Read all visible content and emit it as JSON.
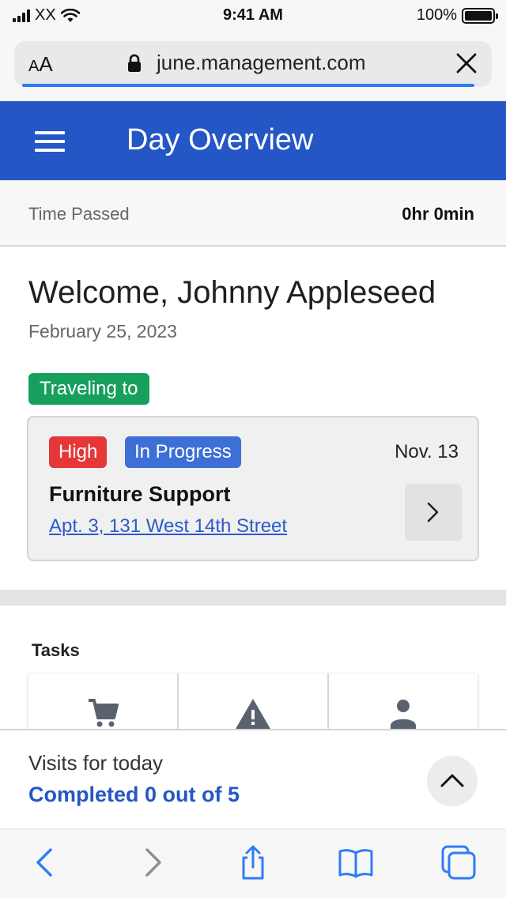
{
  "status_bar": {
    "carrier": "XX",
    "time": "9:41 AM",
    "battery": "100%",
    "battery_level": 1.0
  },
  "url_bar": {
    "text_size_label_small": "A",
    "text_size_label_large": "A",
    "url": "june.management.com"
  },
  "header": {
    "title": "Day Overview"
  },
  "time_passed": {
    "label": "Time Passed",
    "value": "0hr 0min"
  },
  "welcome": {
    "greeting": "Welcome, Johnny Appleseed",
    "date": "February 25, 2023"
  },
  "travel": {
    "badge": "Traveling to"
  },
  "visit_card": {
    "priority": "High",
    "status": "In Progress",
    "date": "Nov. 13",
    "title": "Furniture Support",
    "address": "Apt. 3, 131 West 14th Street"
  },
  "tasks": {
    "label": "Tasks",
    "icons": [
      "cart-icon",
      "warning-icon",
      "person-icon"
    ]
  },
  "visits": {
    "label": "Visits for today",
    "status": "Completed 0 out of 5"
  },
  "colors": {
    "accent": "#2457c5",
    "traveling": "#17a05d",
    "high": "#e53737",
    "in_progress": "#3d6fd6",
    "safari_blue": "#2f7cf6"
  }
}
